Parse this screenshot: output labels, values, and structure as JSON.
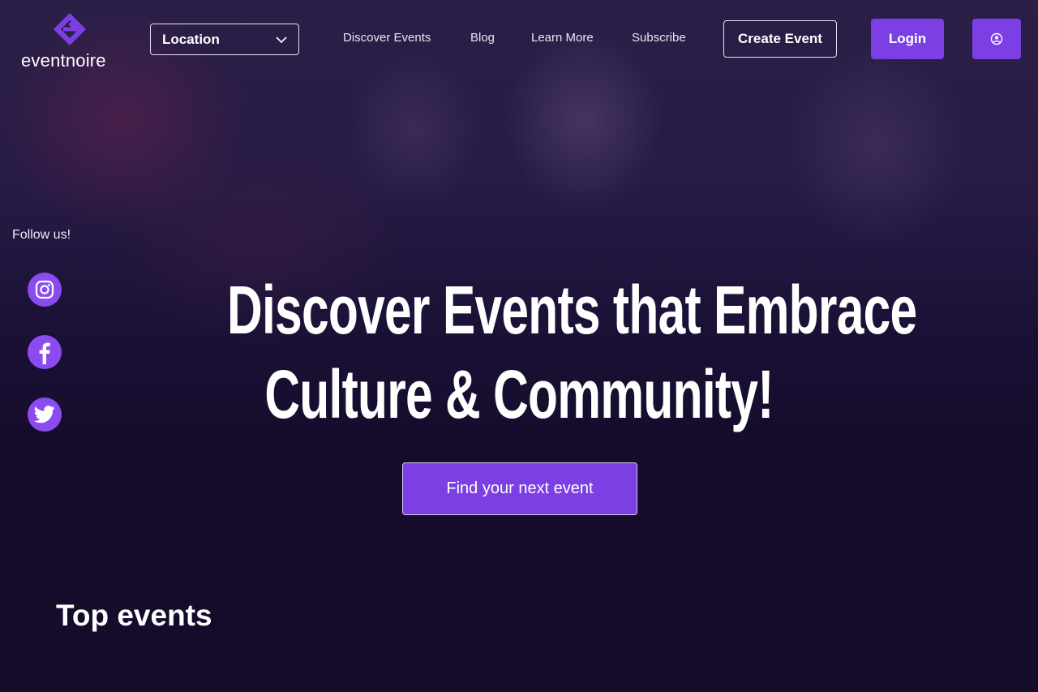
{
  "brand": {
    "name": "eventnoire",
    "accent": "#7b3fe4",
    "background": "#150c2b"
  },
  "header": {
    "location_label": "Location",
    "nav": [
      "Discover Events",
      "Blog",
      "Learn More",
      "Subscribe"
    ],
    "create_event_label": "Create Event",
    "login_label": "Login"
  },
  "social": {
    "label": "Follow us!",
    "icons": [
      "instagram-icon",
      "facebook-icon",
      "twitter-icon"
    ]
  },
  "hero": {
    "title_line1": "Discover Events that Embrace",
    "title_line2": "Culture & Community!",
    "cta_label": "Find your next event"
  },
  "sections": {
    "top_events_title": "Top events"
  }
}
